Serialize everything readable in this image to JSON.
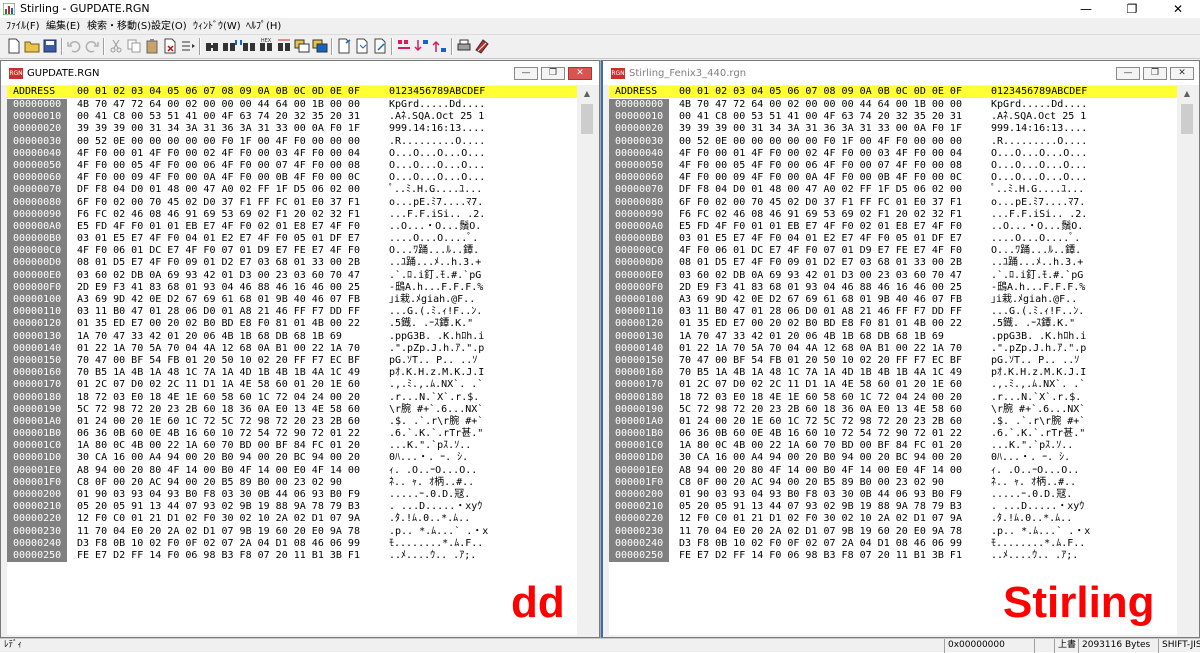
{
  "window": {
    "title": "Stirling - GUPDATE.RGN",
    "icon": "stirling-app-icon"
  },
  "menu": [
    "ﾌｧｲﾙ(F)",
    "編集(E)",
    "検索・移動(S)",
    "設定(O)",
    "ｳｨﾝﾄﾞｳ(W)",
    "ﾍﾙﾌﾟ(H)"
  ],
  "panes": [
    {
      "title": "GUPDATE.RGN",
      "overlay": "dd"
    },
    {
      "title": "Stirling_Fenix3_440.rgn",
      "overlay": "Stirling"
    }
  ],
  "hex_header": {
    "address": "ADDRESS",
    "columns": "00 01 02 03 04 05 06 07 08 09 0A 0B 0C 0D 0E 0F",
    "ascii": "0123456789ABCDEF"
  },
  "hex_rows": [
    {
      "a": "00000000",
      "h": "4B 70 47 72 64 00 02 00 00 00 44 64 00 1B 00 00",
      "t": "KpGrd.....Dd...."
    },
    {
      "a": "00000010",
      "h": "00 41 C8 00 53 51 41 00 4F 63 74 20 32 35 20 31",
      "t": ".Aﾈ.SQA.Oct 25 1"
    },
    {
      "a": "00000020",
      "h": "39 39 39 00 31 34 3A 31 36 3A 31 33 00 0A F0 1F",
      "t": "999.14:16:13...."
    },
    {
      "a": "00000030",
      "h": "00 52 0E 00 00 00 00 00 F0 1F 00 4F F0 00 00 00",
      "t": ".R.........O...."
    },
    {
      "a": "00000040",
      "h": "4F F0 00 01 4F F0 00 02 4F F0 00 03 4F F0 00 04",
      "t": "O...O...O...O..."
    },
    {
      "a": "00000050",
      "h": "4F F0 00 05 4F F0 00 06 4F F0 00 07 4F F0 00 08",
      "t": "O...O...O...O..."
    },
    {
      "a": "00000060",
      "h": "4F F0 00 09 4F F0 00 0A 4F F0 00 0B 4F F0 00 0C",
      "t": "O...O...O...O..."
    },
    {
      "a": "00000070",
      "h": "DF F8 04 D0 01 48 00 47 A0 02 FF 1F D5 06 02 00",
      "t": "ﾟ..ﾐ.H.G....ﾕ..."
    },
    {
      "a": "00000080",
      "h": "6F F0 02 00 70 45 02 D0 37 F1 FF FC 01 E0 37 F1",
      "t": "o...pE.ﾐ7....ﾏ7."
    },
    {
      "a": "00000090",
      "h": "F6 FC 02 46 08 46 91 69 53 69 02 F1 20 02 32 F1",
      "t": "...F.F.iSi.. .2."
    },
    {
      "a": "000000A0",
      "h": "E5 FD 4F F0 01 01 EB E7 4F F0 02 01 E8 E7 4F F0",
      "t": "..O...・O...鬚O."
    },
    {
      "a": "000000B0",
      "h": "03 01 E5 E7 4F F0 04 01 E2 E7 4F F0 05 01 DF E7",
      "t": "....O...O....ﾟ."
    },
    {
      "a": "000000C0",
      "h": "4F F0 06 01 DC E7 4F F0 07 01 D9 E7 FE E7 4F F0",
      "t": "O...ﾜ踊...ﾙ..鐔."
    },
    {
      "a": "000000D0",
      "h": "08 01 D5 E7 4F F0 09 01 D2 E7 03 68 01 33 00 2B",
      "t": "..ﾕ踊...ﾒ..h.3.+"
    },
    {
      "a": "000000E0",
      "h": "03 60 02 DB 0A 69 93 42 01 D3 00 23 03 60 70 47",
      "t": ".`.ﾛ.i釘.ﾓ.#.`pG"
    },
    {
      "a": "000000F0",
      "h": "2D E9 F3 41 83 68 01 93 04 46 88 46 16 46 00 25",
      "t": "-鴟A.h...F.F.F.%"
    },
    {
      "a": "00000100",
      "h": "A3 69 9D 42 0E D2 67 69 61 68 01 9B 40 46 07 FB",
      "t": "｣i栽.ﾒgiah.@F.."
    },
    {
      "a": "00000110",
      "h": "03 11 B0 47 01 28 06 D0 01 A8 21 46 FF F7 DD FF",
      "t": "...G.(.ﾐ.ｨ!F..ﾝ."
    },
    {
      "a": "00000120",
      "h": "01 35 ED E7 00 20 02 B0 BD E8 F0 81 01 4B 00 22",
      "t": ".5鐡. .ｰｽ鐔.K.\""
    },
    {
      "a": "00000130",
      "h": "1A 70 47 33 42 01 20 06 4B 1B 68 DB 68 1B 69",
      "t": ".ppG3B. .K.hﾛh.i"
    },
    {
      "a": "00000140",
      "h": "01 22 1A 70 5A 70 04 4A 12 68 0A B1 00 22 1A 70",
      "t": ".\".pZp.J.h.ｱ.\".p"
    },
    {
      "a": "00000150",
      "h": "70 47 00 BF 54 FB 01 20 50 10 02 20 FF F7 EC BF",
      "t": "pG.ｿT.. P.. ..ｿ"
    },
    {
      "a": "00000160",
      "h": "70 B5 1A 4B 1A 48 1C 7A 1A 4D 1B 4B 1B 4A 1C 49",
      "t": "pｵ.K.H.z.M.K.J.I"
    },
    {
      "a": "00000170",
      "h": "01 2C 07 D0 02 2C 11 D1 1A 4E 58 60 01 20 1E 60",
      "t": ".,.ﾐ.,.ﾑ.NX`. .`"
    },
    {
      "a": "00000180",
      "h": "18 72 03 E0 18 4E 1E 60 58 60 1C 72 04 24 00 20",
      "t": ".r...N.`X`.r.$. "
    },
    {
      "a": "00000190",
      "h": "5C 72 98 72 20 23 2B 60 18 36 0A E0 13 4E 58 60",
      "t": "\\r腕 #+`.6...NX`"
    },
    {
      "a": "000001A0",
      "h": "01 24 00 20 1E 60 1C 72 5C 72 98 72 20 23 2B 60",
      "t": ".$. .`.r\\r腕 #+`"
    },
    {
      "a": "000001B0",
      "h": "06 36 0B 60 0E 4B 16 60 10 72 54 72 90 72 01 22",
      "t": ".6.`.K.`.rTr甚.\""
    },
    {
      "a": "000001C0",
      "h": "1A 80 0C 4B 00 22 1A 60 70 BD 00 BF 84 FC 01 20",
      "t": "...K.\".`pｽ.ｿ.. "
    },
    {
      "a": "000001D0",
      "h": "30 CA 16 00 A4 94 00 20 B0 94 00 20 BC 94 00 20",
      "t": "0ﾊ...・. ｰ. ｼ. "
    },
    {
      "a": "000001E0",
      "h": "A8 94 00 20 80 4F 14 00 B0 4F 14 00 E0 4F 14 00",
      "t": "ｨ. .O..ｰO...O.."
    },
    {
      "a": "000001F0",
      "h": "C8 0F 00 20 AC 94 00 20 B5 89 B0 00 23 02 90",
      "t": "ﾈ.. ｬ. ｵ柄..#.."
    },
    {
      "a": "00000200",
      "h": "01 90 03 93 04 93 B0 F8 03 30 0B 44 06 93 B0 F9",
      "t": ".....ｰ.0.D.冦."
    },
    {
      "a": "00000210",
      "h": "05 20 05 91 13 44 07 93 02 9B 19 88 9A 78 79 B3",
      "t": ". ...D.....・xyｳ"
    },
    {
      "a": "00000220",
      "h": "12 F0 C0 01 21 D1 02 F0 30 02 10 2A 02 D1 07 9A",
      "t": ".ﾀ.!ﾑ.0..*.ﾑ.."
    },
    {
      "a": "00000230",
      "h": "11 70 04 E0 20 2A 02 D1 07 9B 19 60 20 E0 9A 78",
      "t": ".p.. *.ﾑ...` .・x"
    },
    {
      "a": "00000240",
      "h": "D3 F8 0B 10 02 F0 0F 02 07 2A 04 D1 08 46 06 99",
      "t": "ﾓ........*.ﾑ.F.."
    },
    {
      "a": "00000250",
      "h": "FE E7 D2 FF 14 F0 06 98 B3 F8 07 20 11 B1 3B F1",
      "t": "..ﾒ....ｳ.. .ｱ;."
    }
  ],
  "status": {
    "ready": "ﾚﾃﾞｨ",
    "offset": "0x00000000",
    "mode": "上書",
    "size": "2093116 Bytes",
    "encoding": "SHIFT-JIS"
  },
  "colors": {
    "header_bg": "#ffff33",
    "address_bg": "#808080",
    "overlay_text": "#ff0000",
    "active_border": "#3a6ea5"
  }
}
